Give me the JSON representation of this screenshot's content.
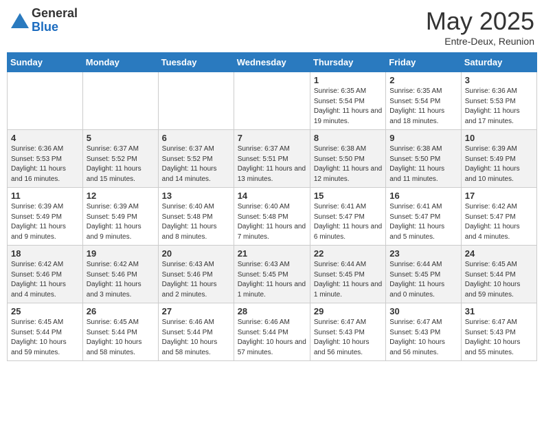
{
  "logo": {
    "general": "General",
    "blue": "Blue"
  },
  "title": "May 2025",
  "subtitle": "Entre-Deux, Reunion",
  "days_of_week": [
    "Sunday",
    "Monday",
    "Tuesday",
    "Wednesday",
    "Thursday",
    "Friday",
    "Saturday"
  ],
  "weeks": [
    [
      {
        "day": "",
        "info": ""
      },
      {
        "day": "",
        "info": ""
      },
      {
        "day": "",
        "info": ""
      },
      {
        "day": "",
        "info": ""
      },
      {
        "day": "1",
        "info": "Sunrise: 6:35 AM\nSunset: 5:54 PM\nDaylight: 11 hours and 19 minutes."
      },
      {
        "day": "2",
        "info": "Sunrise: 6:35 AM\nSunset: 5:54 PM\nDaylight: 11 hours and 18 minutes."
      },
      {
        "day": "3",
        "info": "Sunrise: 6:36 AM\nSunset: 5:53 PM\nDaylight: 11 hours and 17 minutes."
      }
    ],
    [
      {
        "day": "4",
        "info": "Sunrise: 6:36 AM\nSunset: 5:53 PM\nDaylight: 11 hours and 16 minutes."
      },
      {
        "day": "5",
        "info": "Sunrise: 6:37 AM\nSunset: 5:52 PM\nDaylight: 11 hours and 15 minutes."
      },
      {
        "day": "6",
        "info": "Sunrise: 6:37 AM\nSunset: 5:52 PM\nDaylight: 11 hours and 14 minutes."
      },
      {
        "day": "7",
        "info": "Sunrise: 6:37 AM\nSunset: 5:51 PM\nDaylight: 11 hours and 13 minutes."
      },
      {
        "day": "8",
        "info": "Sunrise: 6:38 AM\nSunset: 5:50 PM\nDaylight: 11 hours and 12 minutes."
      },
      {
        "day": "9",
        "info": "Sunrise: 6:38 AM\nSunset: 5:50 PM\nDaylight: 11 hours and 11 minutes."
      },
      {
        "day": "10",
        "info": "Sunrise: 6:39 AM\nSunset: 5:49 PM\nDaylight: 11 hours and 10 minutes."
      }
    ],
    [
      {
        "day": "11",
        "info": "Sunrise: 6:39 AM\nSunset: 5:49 PM\nDaylight: 11 hours and 9 minutes."
      },
      {
        "day": "12",
        "info": "Sunrise: 6:39 AM\nSunset: 5:49 PM\nDaylight: 11 hours and 9 minutes."
      },
      {
        "day": "13",
        "info": "Sunrise: 6:40 AM\nSunset: 5:48 PM\nDaylight: 11 hours and 8 minutes."
      },
      {
        "day": "14",
        "info": "Sunrise: 6:40 AM\nSunset: 5:48 PM\nDaylight: 11 hours and 7 minutes."
      },
      {
        "day": "15",
        "info": "Sunrise: 6:41 AM\nSunset: 5:47 PM\nDaylight: 11 hours and 6 minutes."
      },
      {
        "day": "16",
        "info": "Sunrise: 6:41 AM\nSunset: 5:47 PM\nDaylight: 11 hours and 5 minutes."
      },
      {
        "day": "17",
        "info": "Sunrise: 6:42 AM\nSunset: 5:47 PM\nDaylight: 11 hours and 4 minutes."
      }
    ],
    [
      {
        "day": "18",
        "info": "Sunrise: 6:42 AM\nSunset: 5:46 PM\nDaylight: 11 hours and 4 minutes."
      },
      {
        "day": "19",
        "info": "Sunrise: 6:42 AM\nSunset: 5:46 PM\nDaylight: 11 hours and 3 minutes."
      },
      {
        "day": "20",
        "info": "Sunrise: 6:43 AM\nSunset: 5:46 PM\nDaylight: 11 hours and 2 minutes."
      },
      {
        "day": "21",
        "info": "Sunrise: 6:43 AM\nSunset: 5:45 PM\nDaylight: 11 hours and 1 minute."
      },
      {
        "day": "22",
        "info": "Sunrise: 6:44 AM\nSunset: 5:45 PM\nDaylight: 11 hours and 1 minute."
      },
      {
        "day": "23",
        "info": "Sunrise: 6:44 AM\nSunset: 5:45 PM\nDaylight: 11 hours and 0 minutes."
      },
      {
        "day": "24",
        "info": "Sunrise: 6:45 AM\nSunset: 5:44 PM\nDaylight: 10 hours and 59 minutes."
      }
    ],
    [
      {
        "day": "25",
        "info": "Sunrise: 6:45 AM\nSunset: 5:44 PM\nDaylight: 10 hours and 59 minutes."
      },
      {
        "day": "26",
        "info": "Sunrise: 6:45 AM\nSunset: 5:44 PM\nDaylight: 10 hours and 58 minutes."
      },
      {
        "day": "27",
        "info": "Sunrise: 6:46 AM\nSunset: 5:44 PM\nDaylight: 10 hours and 58 minutes."
      },
      {
        "day": "28",
        "info": "Sunrise: 6:46 AM\nSunset: 5:44 PM\nDaylight: 10 hours and 57 minutes."
      },
      {
        "day": "29",
        "info": "Sunrise: 6:47 AM\nSunset: 5:43 PM\nDaylight: 10 hours and 56 minutes."
      },
      {
        "day": "30",
        "info": "Sunrise: 6:47 AM\nSunset: 5:43 PM\nDaylight: 10 hours and 56 minutes."
      },
      {
        "day": "31",
        "info": "Sunrise: 6:47 AM\nSunset: 5:43 PM\nDaylight: 10 hours and 55 minutes."
      }
    ]
  ]
}
